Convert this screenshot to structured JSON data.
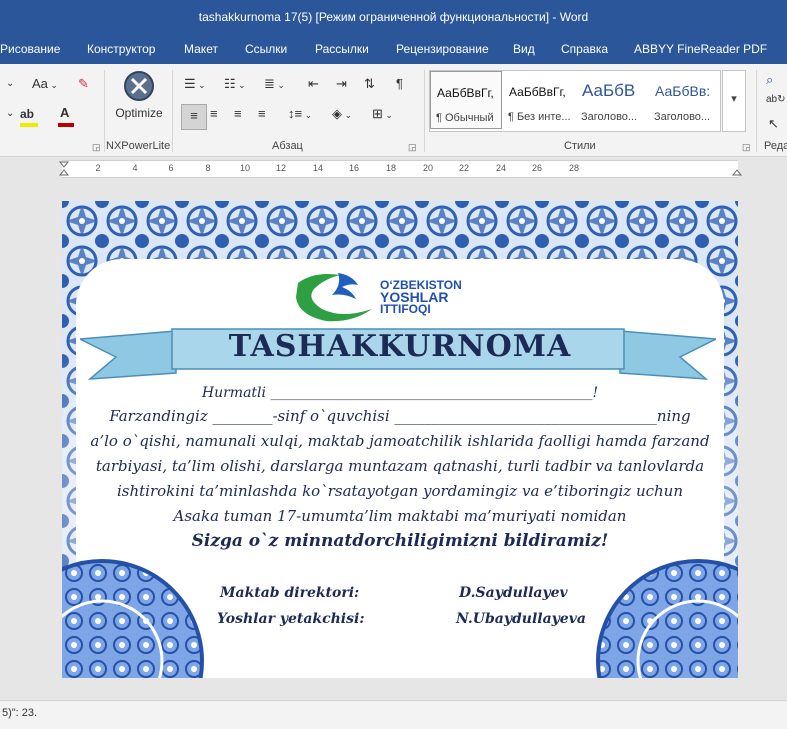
{
  "window": {
    "title": "tashakkurnoma 17(5) [Режим ограниченной функциональности]  -  Word"
  },
  "menu": [
    "Рисование",
    "Конструктор",
    "Макет",
    "Ссылки",
    "Рассылки",
    "Рецензирование",
    "Вид",
    "Справка",
    "ABBYY FineReader PDF"
  ],
  "ribbon": {
    "font_size_symbol": "Aa",
    "optimize_label": "Optimize",
    "nxpowerlite_label": "NXPowerLite",
    "paragraph_label": "Абзац",
    "styles_label": "Стили",
    "editing_label": "Реда",
    "styles": [
      {
        "preview": "АаБбВвГг,",
        "name": "¶ Обычный"
      },
      {
        "preview": "АаБбВвГг,",
        "name": "¶ Без инте..."
      },
      {
        "preview": "АаБбВ",
        "name": "Заголово..."
      },
      {
        "preview": "АаБбВв:",
        "name": "Заголово..."
      }
    ]
  },
  "ruler": {
    "numbers": [
      "2",
      "4",
      "6",
      "8",
      "10",
      "12",
      "14",
      "16",
      "18",
      "20",
      "22",
      "24",
      "26",
      "28"
    ]
  },
  "document": {
    "logo": {
      "line1": "O‘ZBEKISTON",
      "line2": "YOSHLAR",
      "line3": "ITTIFOQI"
    },
    "heading": "TASHAKKURNOMA",
    "greeting": "Hurmatli ______________________________________________!",
    "body_lines": [
      "Farzandingiz ________-sinf o`quvchisi ___________________________________ning",
      "a’lo o`qishi, namunali xulqi, maktab jamoatchilik ishlarida faolligi hamda farzand",
      "tarbiyasi, ta’lim olishi, darslarga muntazam qatnashi, turli tadbir va tanlovlarda",
      "ishtirokini ta’minlashda ko`rsatayotgan yordamingiz va e’tiboringiz uchun",
      "Asaka tuman 17-umumta’lim maktabi ma’muriyati nomidan"
    ],
    "gratitude": "Sizga o`z minnatdorchiligimizni bildiramiz!",
    "signatures": [
      {
        "role": "Maktab direktori:",
        "name": "D.Saydullayev"
      },
      {
        "role": "Yoshlar yetakchisi:",
        "name": "N.Ubaydullayeva"
      }
    ]
  },
  "status": {
    "text": "5)\": 23."
  },
  "colors": {
    "word_blue": "#2b579a",
    "ornament_blue": "#2f5fb0",
    "heading_navy": "#1c2a55",
    "ribbon_banner": "#a9d6ea"
  }
}
